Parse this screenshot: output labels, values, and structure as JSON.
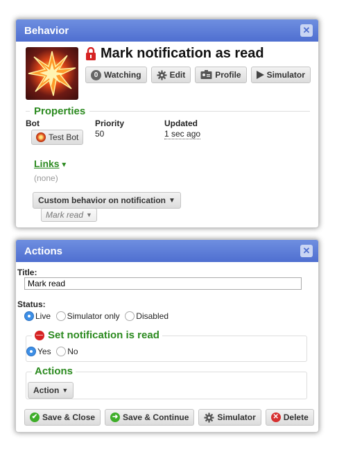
{
  "behavior_panel": {
    "header": "Behavior",
    "close_glyph": "✕",
    "title": "Mark notification as read",
    "buttons": {
      "watching_count": "0",
      "watching": "Watching",
      "edit": "Edit",
      "profile": "Profile",
      "simulator": "Simulator"
    },
    "properties": {
      "title": "Properties",
      "bot_label": "Bot",
      "bot_value": "Test Bot",
      "priority_label": "Priority",
      "priority_value": "50",
      "updated_label": "Updated",
      "updated_value": "1 sec ago"
    },
    "links": {
      "title": "Links",
      "caret": "▾",
      "empty": "(none)"
    },
    "custom_behavior_button": "Custom behavior on notification",
    "mark_read_chip": "Mark read"
  },
  "actions_panel": {
    "header": "Actions",
    "close_glyph": "✕",
    "title_label": "Title:",
    "title_value": "Mark read",
    "status_label": "Status:",
    "status_options": [
      "Live",
      "Simulator only",
      "Disabled"
    ],
    "status_selected": "Live",
    "set_read_section": {
      "title": "Set notification is read",
      "options": [
        "Yes",
        "No"
      ],
      "selected": "Yes"
    },
    "actions_section": {
      "title": "Actions",
      "action_button": "Action"
    },
    "footer": {
      "save_close": "Save & Close",
      "save_continue": "Save & Continue",
      "simulator": "Simulator",
      "delete": "Delete"
    }
  },
  "colors": {
    "header_blue": "#5577d8",
    "section_green": "#2b8a1f",
    "radio_blue": "#3d8fe6",
    "lock_red": "#d62222",
    "delete_red": "#d63030",
    "save_green": "#3fae2a"
  },
  "icons": {
    "lock": "lock-icon",
    "watching": "zero-badge-icon",
    "edit": "gear-icon",
    "profile": "profile-card-icon",
    "simulator": "play-icon",
    "bot": "explosion-icon",
    "save_close": "check-circle-icon",
    "save_continue": "arrow-circle-icon",
    "delete": "x-circle-icon",
    "set_read": "minus-circle-icon"
  }
}
